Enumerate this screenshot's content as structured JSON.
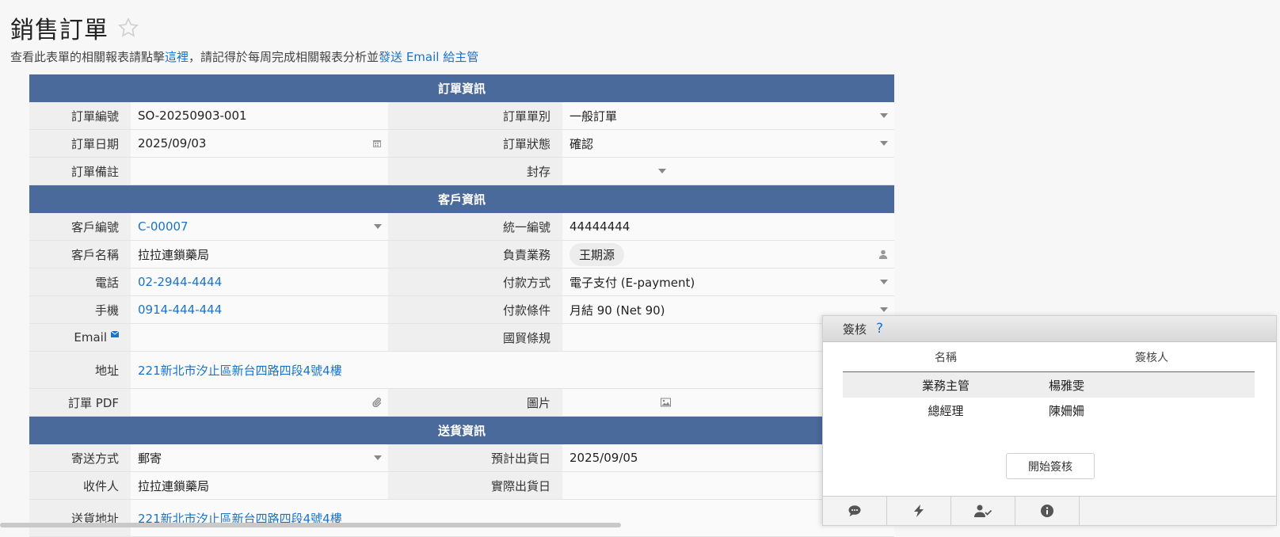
{
  "page": {
    "title": "銷售訂單",
    "subtitle_prefix": "查看此表單的相關報表請點擊",
    "subtitle_link1": "這裡",
    "subtitle_middle": "，請記得於每周完成相關報表分析並",
    "subtitle_link2": "發送 Email 給主管"
  },
  "sections": {
    "order": "訂單資訊",
    "customer": "客戶資訊",
    "shipping": "送貨資訊"
  },
  "order": {
    "no_label": "訂單編號",
    "no_value": "SO-20250903-001",
    "type_label": "訂單單別",
    "type_value": "一般訂單",
    "date_label": "訂單日期",
    "date_value": "2025/09/03",
    "status_label": "訂單狀態",
    "status_value": "確認",
    "note_label": "訂單備註",
    "note_value": "",
    "archive_label": "封存",
    "archive_value": ""
  },
  "customer": {
    "id_label": "客戶編號",
    "id_value": "C-00007",
    "tax_label": "統一編號",
    "tax_value": "44444444",
    "name_label": "客戶名稱",
    "name_value": "拉拉連鎖藥局",
    "sales_label": "負責業務",
    "sales_value": "王期源",
    "phone_label": "電話",
    "phone_value": "02-2944-4444",
    "pay_method_label": "付款方式",
    "pay_method_value": "電子支付 (E-payment)",
    "mobile_label": "手機",
    "mobile_value": "0914-444-444",
    "pay_terms_label": "付款條件",
    "pay_terms_value": "月結 90 (Net 90)",
    "email_label": "Email",
    "email_value": "",
    "incoterm_label": "國貿條規",
    "incoterm_value": "",
    "address_label": "地址",
    "address_value": "221新北市汐止區新台四路四段4號4樓",
    "pdf_label": "訂單 PDF",
    "pdf_value": "",
    "image_label": "圖片",
    "image_value": ""
  },
  "shipping": {
    "method_label": "寄送方式",
    "method_value": "郵寄",
    "est_date_label": "預計出貨日",
    "est_date_value": "2025/09/05",
    "receiver_label": "收件人",
    "receiver_value": "拉拉連鎖藥局",
    "actual_date_label": "實際出貨日",
    "actual_date_value": "",
    "address_label": "送貨地址",
    "address_value": "221新北市汐止區新台四路四段4號4樓"
  },
  "approval": {
    "title": "簽核",
    "help": "?",
    "col_name": "名稱",
    "col_approver": "簽核人",
    "rows": [
      {
        "name": "業務主管",
        "approver": "楊雅雯"
      },
      {
        "name": "總經理",
        "approver": "陳姍姍"
      }
    ],
    "start_button": "開始簽核"
  },
  "toolbar_icons": [
    "comment-icon",
    "lightning-icon",
    "user-check-icon",
    "info-icon"
  ],
  "colors": {
    "section_header": "#4a6a9c",
    "link": "#1a73c8",
    "label_bg": "#efefef",
    "value_bg": "#fafafa"
  }
}
